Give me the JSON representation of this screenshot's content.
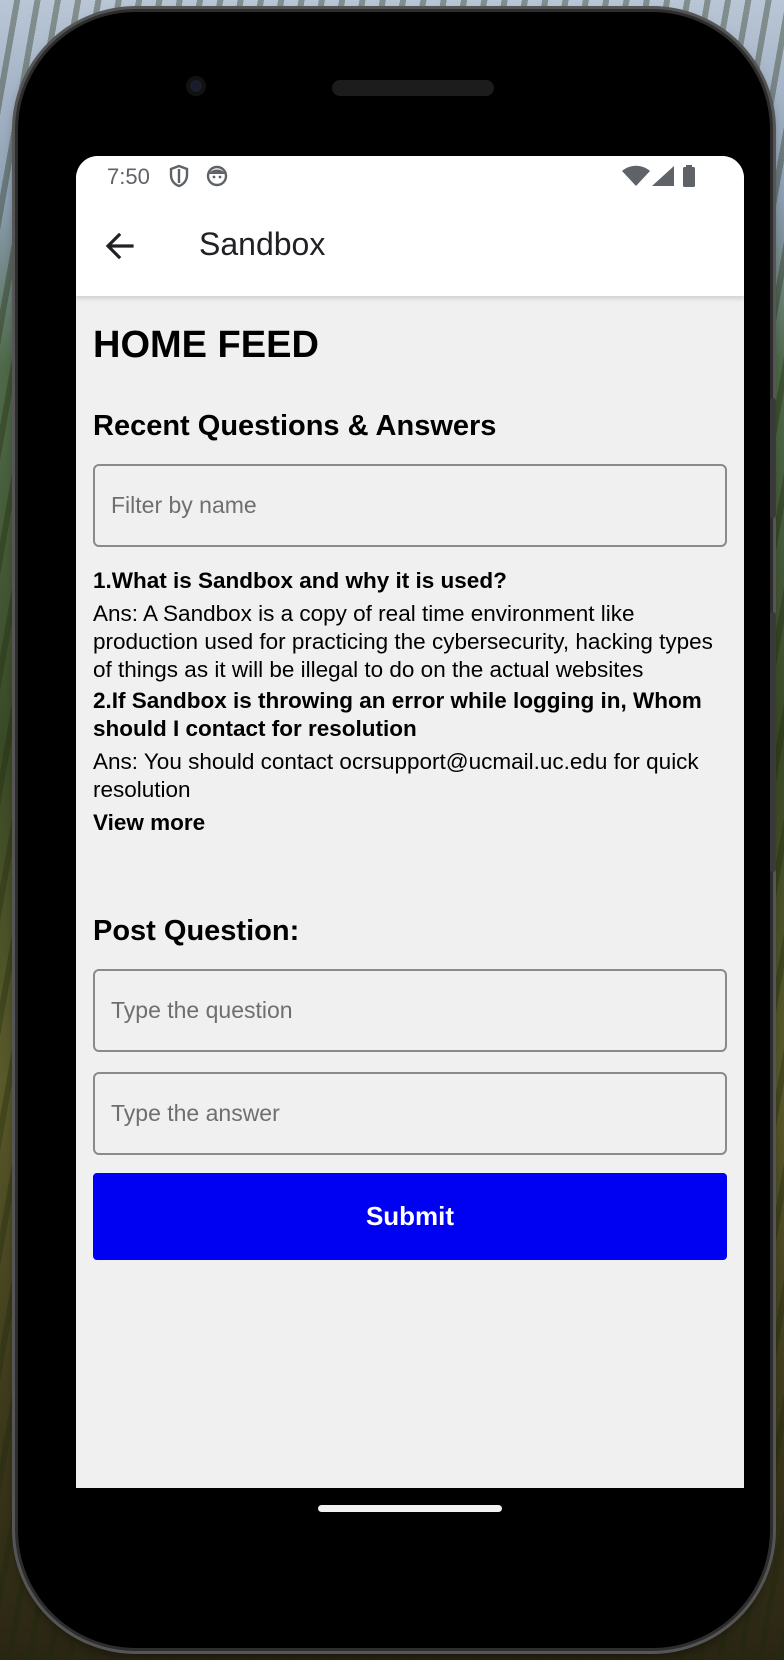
{
  "status_bar": {
    "time": "7:50",
    "icons": [
      "shield-icon",
      "face-icon",
      "wifi-icon",
      "signal-icon",
      "battery-icon"
    ]
  },
  "app_bar": {
    "title": "Sandbox",
    "back_icon": "arrow-back-icon"
  },
  "page": {
    "heading": "HOME FEED",
    "recent_section_title": "Recent Questions & Answers",
    "filter_placeholder": "Filter by name",
    "qa_items": [
      {
        "question": "1.What is Sandbox and why it is used?",
        "answer": "Ans: A Sandbox is a copy of real time environment like production used for practicing the cybersecurity, hacking types of things as it will be illegal to do on the actual websites"
      },
      {
        "question": "2.If Sandbox is throwing an error while logging in, Whom should I contact for resolution",
        "answer": "Ans: You should contact ocrsupport@ucmail.uc.edu for quick resolution"
      }
    ],
    "view_more_label": "View more",
    "post_section_title": "Post Question:",
    "question_placeholder": "Type the question",
    "answer_placeholder": "Type the answer",
    "submit_label": "Submit"
  },
  "colors": {
    "submit_bg": "#0000f2",
    "screen_bg": "#f0f0f0",
    "bar_bg": "#ffffff"
  }
}
